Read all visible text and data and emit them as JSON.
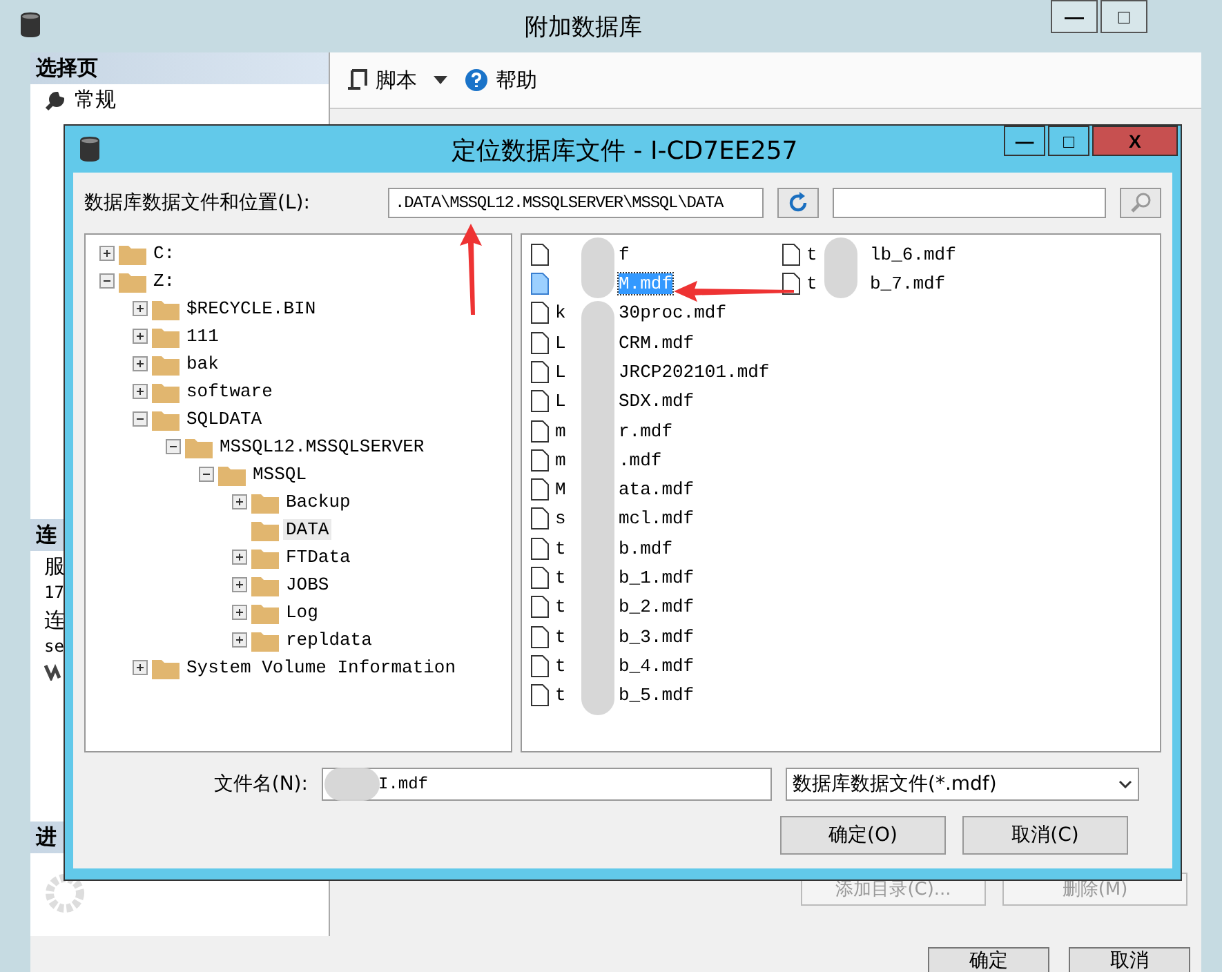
{
  "window": {
    "title": "附加数据库",
    "controls": [
      "—",
      "□"
    ]
  },
  "sidebar": {
    "sections": [
      {
        "title": "选择页",
        "items": [
          {
            "label": "常规",
            "kind": "page"
          }
        ]
      },
      {
        "title": "连",
        "items": [
          {
            "label": "服",
            "kind": "text"
          },
          {
            "label": "17",
            "kind": "mono"
          },
          {
            "label": "连",
            "kind": "text"
          },
          {
            "label": "se",
            "kind": "mono"
          },
          {
            "kind": "link-icon"
          }
        ]
      },
      {
        "title": "进",
        "items": [
          {
            "kind": "spinner"
          }
        ]
      }
    ]
  },
  "toolbar": {
    "items": [
      {
        "label": "脚本",
        "kind": "script"
      },
      {
        "label": "帮助",
        "kind": "help"
      }
    ]
  },
  "main_buttons": [
    {
      "label": "添加目录(C)...",
      "disabled": true
    },
    {
      "label": "删除(M)",
      "disabled": true
    }
  ],
  "footer_buttons": [
    {
      "label": "确定"
    },
    {
      "label": "取消"
    }
  ],
  "dialog": {
    "title": "定位数据库文件 - I-CD7EE257",
    "controls": [
      "—",
      "□",
      "X"
    ],
    "location_label": "数据库数据文件和位置(L):",
    "location_value": ".DATA\\MSSQL12.MSSQLSERVER\\MSSQL\\DATA",
    "tree": [
      {
        "label": "C:",
        "expanded": false,
        "selected": false
      },
      {
        "label": "Z:",
        "expanded": true,
        "selected": false,
        "children": [
          {
            "label": "$RECYCLE.BIN",
            "expanded": false,
            "selected": false
          },
          {
            "label": "111",
            "expanded": false,
            "selected": false
          },
          {
            "label": "bak",
            "expanded": false,
            "selected": false
          },
          {
            "label": "software",
            "expanded": false,
            "selected": false
          },
          {
            "label": "SQLDATA",
            "expanded": true,
            "selected": false,
            "children": [
              {
                "label": "MSSQL12.MSSQLSERVER",
                "expanded": true,
                "selected": false,
                "children": [
                  {
                    "label": "MSSQL",
                    "expanded": true,
                    "selected": false,
                    "children": [
                      {
                        "label": "Backup",
                        "expanded": false,
                        "selected": false
                      },
                      {
                        "label": "DATA",
                        "selected": true
                      },
                      {
                        "label": "FTData",
                        "expanded": false,
                        "selected": false
                      },
                      {
                        "label": "JOBS",
                        "expanded": false,
                        "selected": false
                      },
                      {
                        "label": "Log",
                        "expanded": false,
                        "selected": false
                      },
                      {
                        "label": "repldata",
                        "expanded": false,
                        "selected": false
                      }
                    ]
                  }
                ]
              }
            ]
          },
          {
            "label": "System Volume Information",
            "expanded": false,
            "selected": false
          }
        ]
      }
    ],
    "files": [
      {
        "tail": "f",
        "selected": false
      },
      {
        "tail": "M.mdf",
        "selected": true
      },
      {
        "head": "k",
        "tail": "30proc.mdf",
        "selected": false
      },
      {
        "head": "L",
        "tail": "CRM.mdf",
        "selected": false
      },
      {
        "head": "L",
        "tail": "JRCP202101.mdf",
        "selected": false
      },
      {
        "head": "L",
        "tail": "SDX.mdf",
        "selected": false
      },
      {
        "head": "m",
        "tail": "r.mdf",
        "selected": false
      },
      {
        "head": "m",
        "tail": ".mdf",
        "selected": false
      },
      {
        "head": "M",
        "tail": "ata.mdf",
        "selected": false
      },
      {
        "head": "s",
        "tail": "mcl.mdf",
        "selected": false
      },
      {
        "head": "t",
        "tail": "b.mdf",
        "selected": false
      },
      {
        "head": "t",
        "tail": "b_1.mdf",
        "selected": false
      },
      {
        "head": "t",
        "tail": "b_2.mdf",
        "selected": false
      },
      {
        "head": "t",
        "tail": "b_3.mdf",
        "selected": false
      },
      {
        "head": "t",
        "tail": "b_4.mdf",
        "selected": false
      },
      {
        "head": "t",
        "tail": "b_5.mdf",
        "selected": false
      },
      {
        "head": "t",
        "tail": "lb_6.mdf",
        "selected": false
      },
      {
        "head": "t",
        "tail": "b_7.mdf",
        "selected": false
      }
    ],
    "filename_label": "文件名(N):",
    "filename_value": "I.mdf",
    "filetype": "数据库数据文件(*.mdf)",
    "buttons": [
      "确定(O)",
      "取消(C)"
    ]
  }
}
